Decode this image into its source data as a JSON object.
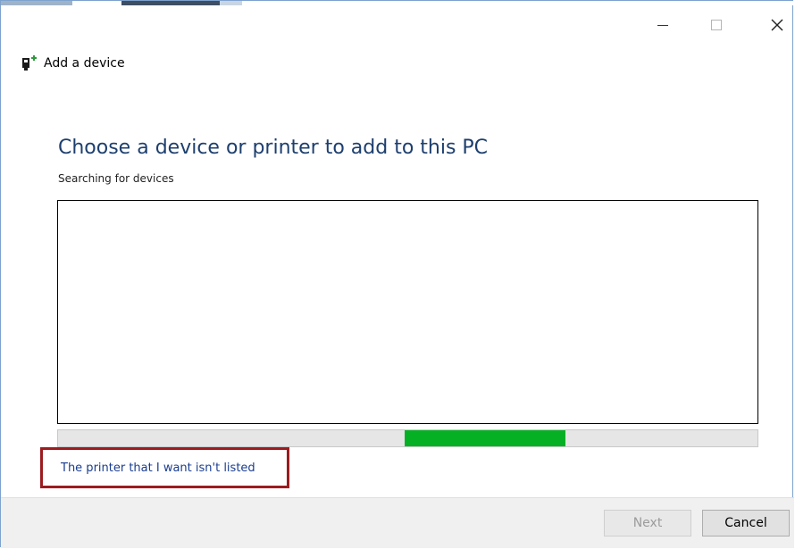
{
  "window": {
    "title": "Add a device",
    "controls": {
      "minimize_icon": "minimize-icon",
      "maximize_icon": "maximize-icon",
      "close_icon": "close-icon"
    },
    "app_icon": "device-add-icon"
  },
  "main": {
    "heading": "Choose a device or printer to add to this PC",
    "status": "Searching for devices",
    "progress": {
      "start_fraction": 0.495,
      "end_fraction": 0.725,
      "color": "#06b025"
    },
    "not_listed_link": "The printer that I want isn't listed",
    "highlight_color": "#9b1c1f"
  },
  "footer": {
    "next_label": "Next",
    "cancel_label": "Cancel"
  }
}
